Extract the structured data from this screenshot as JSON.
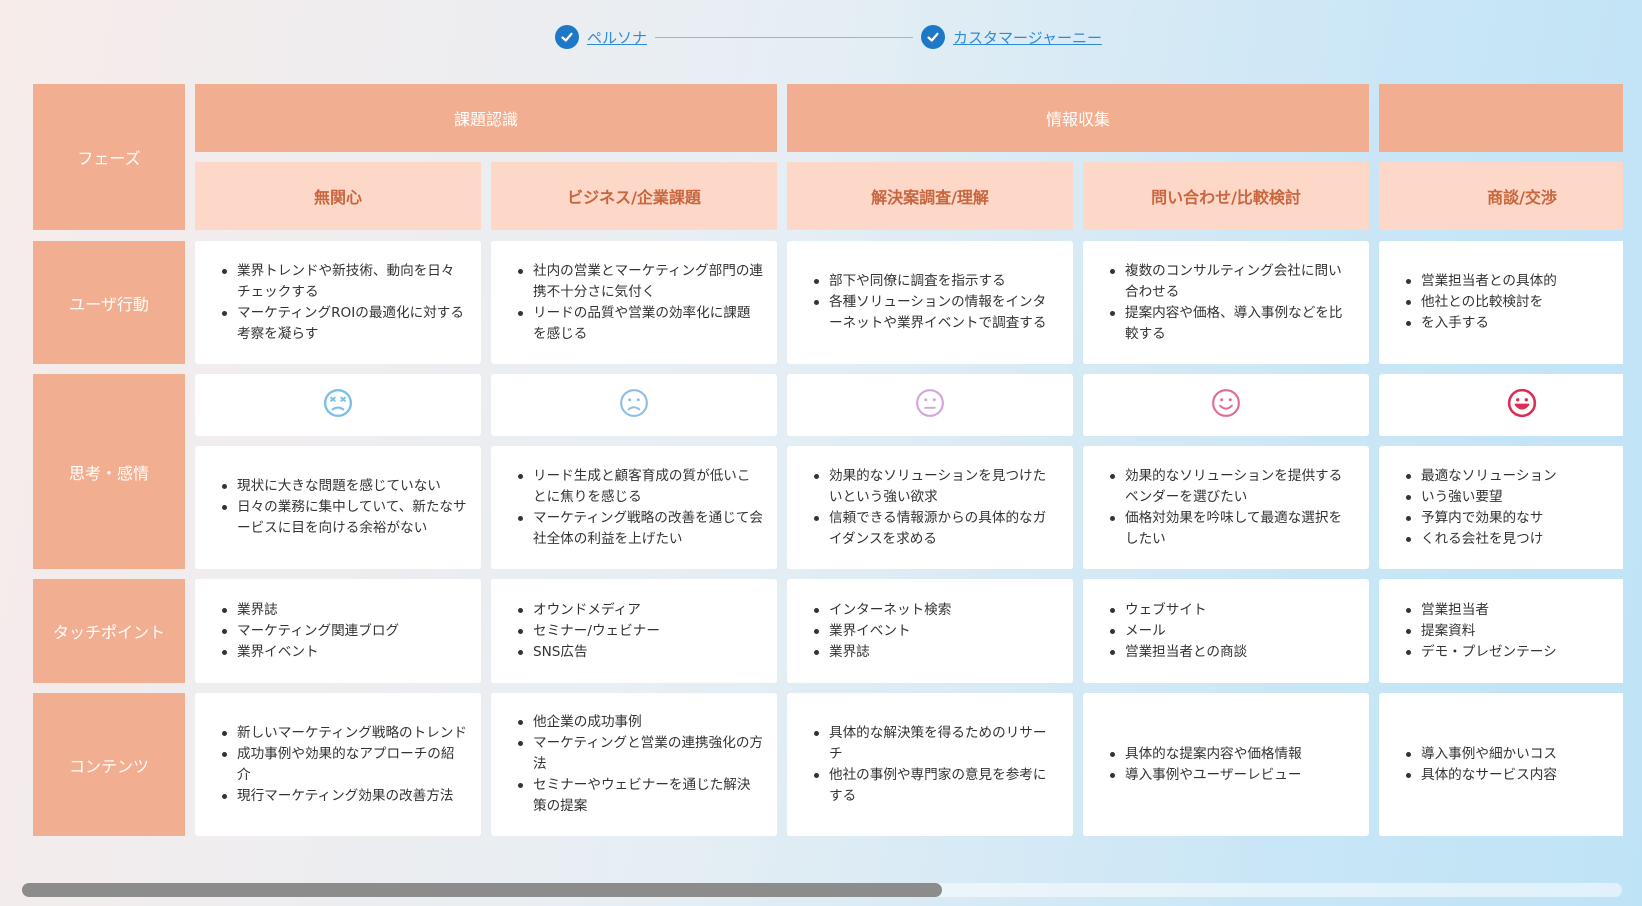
{
  "stepper": {
    "steps": [
      {
        "label": "ペルソナ"
      },
      {
        "label": "カスタマージャーニー"
      }
    ]
  },
  "rows": {
    "phase": "フェーズ",
    "action": "ユーザ行動",
    "thought": "思考・感情",
    "touchpoint": "タッチポイント",
    "content": "コンテンツ"
  },
  "phases": [
    "課題認識",
    "情報収集",
    ""
  ],
  "columns": [
    {
      "title": "無関心",
      "actions": [
        "業界トレンドや新技術、動向を日々チェックする",
        "マーケティングROIの最適化に対する考察を凝らす"
      ],
      "emotion": "dizzy-face-icon",
      "thoughts": [
        "現状に大きな問題を感じていない",
        "日々の業務に集中していて、新たなサービスに目を向ける余裕がない"
      ],
      "touchpoints": [
        "業界誌",
        "マーケティング関連ブログ",
        "業界イベント"
      ],
      "contents": [
        "新しいマーケティング戦略のトレンド",
        "成功事例や効果的なアプローチの紹介",
        "現行マーケティング効果の改善方法"
      ]
    },
    {
      "title": "ビジネス/企業課題",
      "actions": [
        "社内の営業とマーケティング部門の連携不十分さに気付く",
        "リードの品質や営業の効率化に課題を感じる"
      ],
      "emotion": "frown-face-icon",
      "thoughts": [
        "リード生成と顧客育成の質が低いことに焦りを感じる",
        "マーケティング戦略の改善を通じて会社全体の利益を上げたい"
      ],
      "touchpoints": [
        "オウンドメディア",
        "セミナー/ウェビナー",
        "SNS広告"
      ],
      "contents": [
        "他企業の成功事例",
        "マーケティングと営業の連携強化の方法",
        "セミナーやウェビナーを通じた解決策の提案"
      ]
    },
    {
      "title": "解決案調査/理解",
      "actions": [
        "部下や同僚に調査を指示する",
        "各種ソリューションの情報をインターネットや業界イベントで調査する"
      ],
      "emotion": "neutral-face-icon",
      "thoughts": [
        "効果的なソリューションを見つけたいという強い欲求",
        "信頼できる情報源からの具体的なガイダンスを求める"
      ],
      "touchpoints": [
        "インターネット検索",
        "業界イベント",
        "業界誌"
      ],
      "contents": [
        "具体的な解決策を得るためのリサーチ",
        "他社の事例や専門家の意見を参考にする"
      ]
    },
    {
      "title": "問い合わせ/比較検討",
      "actions": [
        "複数のコンサルティング会社に問い合わせる",
        "提案内容や価格、導入事例などを比較する"
      ],
      "emotion": "smile-face-icon",
      "thoughts": [
        "効果的なソリューションを提供するベンダーを選びたい",
        "価格対効果を吟味して最適な選択をしたい"
      ],
      "touchpoints": [
        "ウェブサイト",
        "メール",
        "営業担当者との商談"
      ],
      "contents": [
        "具体的な提案内容や価格情報",
        "導入事例やユーザーレビュー"
      ]
    },
    {
      "title": "商談/交渉",
      "actions": [
        "営業担当者との具体的",
        "他社との比較検討を",
        "を入手する"
      ],
      "emotion": "grin-face-icon",
      "thoughts": [
        "最適なソリューション",
        "いう強い要望",
        "予算内で効果的なサ",
        "くれる会社を見つけ"
      ],
      "touchpoints": [
        "営業担当者",
        "提案資料",
        "デモ・プレゼンテーシ"
      ],
      "contents": [
        "導入事例や細かいコス",
        "具体的なサービス内容"
      ]
    }
  ],
  "colors": {
    "phase_bg": "#f2ae90",
    "sub_bg": "#fdd8c8",
    "sub_text": "#c8673f",
    "link": "#2e8bd8",
    "check": "#1d79c8",
    "emotions": [
      "#7cc0ea",
      "#8fbfe3",
      "#d2a6d8",
      "#e36a97",
      "#dc2f55"
    ]
  }
}
